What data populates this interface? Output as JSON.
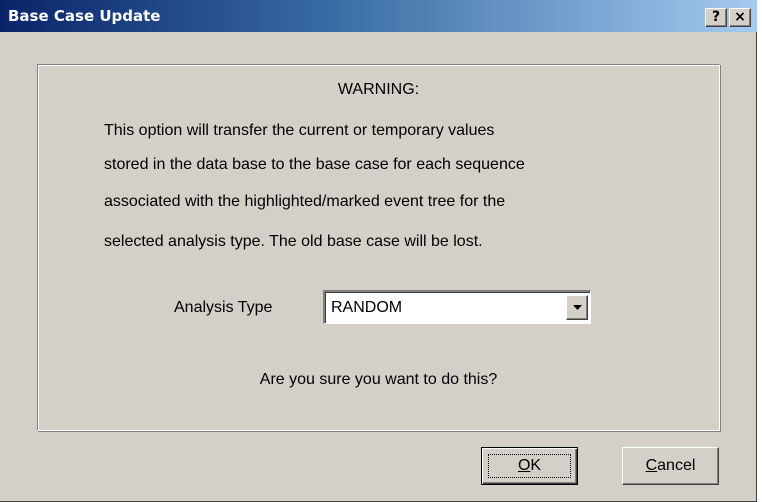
{
  "window": {
    "title": "Base Case Update",
    "help_button_label": "?",
    "close_button_label": "×"
  },
  "dialog": {
    "warning_title": "WARNING:",
    "message_lines": [
      "This option will transfer the current or temporary values",
      "stored in the data base to the base case for each  sequence",
      "associated with the highlighted/marked event tree for the",
      "selected analysis type.  The old base case will be lost."
    ],
    "analysis_type_label": "Analysis Type",
    "analysis_type_value": "RANDOM",
    "confirm_question": "Are you sure you want to do this?"
  },
  "buttons": {
    "ok": {
      "mnemonic": "O",
      "rest": "K"
    },
    "cancel": {
      "mnemonic": "C",
      "rest": "ancel"
    }
  },
  "icons": {
    "dropdown": "chevron-down-icon"
  },
  "colors": {
    "titlebar_start": "#0a246a",
    "titlebar_end": "#a6caf0",
    "dialog_face": "#d4d0c8"
  }
}
